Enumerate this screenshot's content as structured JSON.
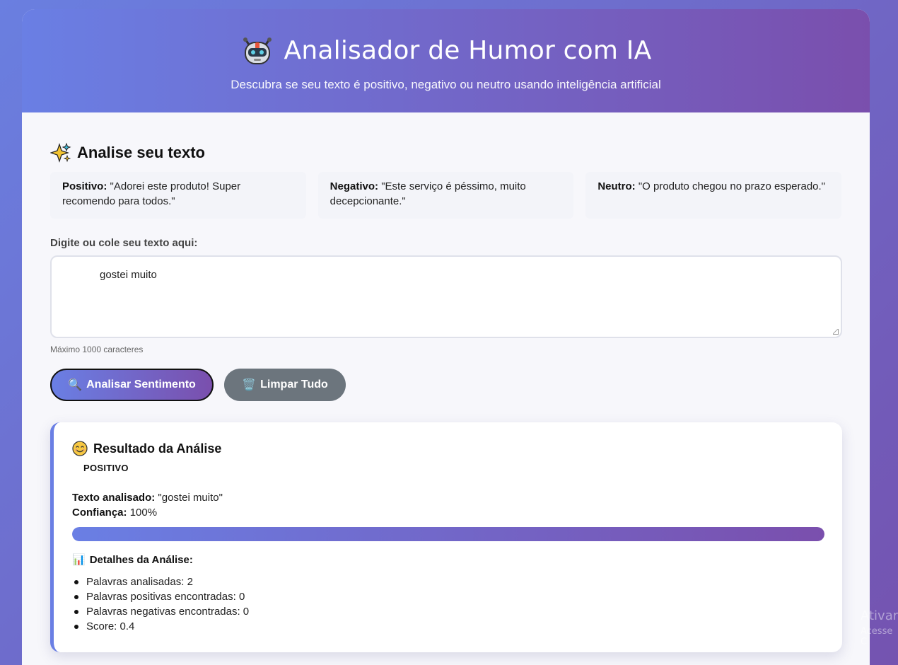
{
  "header": {
    "title": "Analisador de Humor com IA",
    "subtitle": "Descubra se seu texto é positivo, negativo ou neutro usando inteligência artificial",
    "icon": "robot-icon"
  },
  "analyze_section": {
    "title": "Analise seu texto",
    "icon": "sparkle-icon",
    "examples": [
      {
        "label": "Positivo:",
        "text": "\"Adorei este produto! Super recomendo para todos.\""
      },
      {
        "label": "Negativo:",
        "text": "\"Este serviço é péssimo, muito decepcionante.\""
      },
      {
        "label": "Neutro:",
        "text": "\"O produto chegou no prazo esperado.\""
      }
    ],
    "input_label": "Digite ou cole seu texto aqui:",
    "input_value": "gostei muito",
    "hint": "Máximo 1000 caracteres"
  },
  "buttons": {
    "analyze_label": "Analisar Sentimento",
    "analyze_icon": "🔍",
    "clear_label": "Limpar Tudo",
    "clear_icon": "🗑️"
  },
  "result": {
    "title": "Resultado da Análise",
    "sentiment_badge": "POSITIVO",
    "analyzed_label": "Texto analisado:",
    "analyzed_text": "\"gostei muito\"",
    "confidence_label": "Confiança:",
    "confidence_text": "100%",
    "confidence_value": 1.0,
    "details_icon": "📊",
    "details_title": "Detalhes da Análise:",
    "details": [
      "Palavras analisadas: 2",
      "Palavras positivas encontradas: 0",
      "Palavras negativas encontradas: 0",
      "Score: 0.4"
    ]
  },
  "watermark": {
    "line1": "Ativar",
    "line2": "Acesse C"
  },
  "colors": {
    "accent_start": "#6a7fe4",
    "accent_end": "#7a4fad",
    "secondary_button": "#6c757d"
  }
}
